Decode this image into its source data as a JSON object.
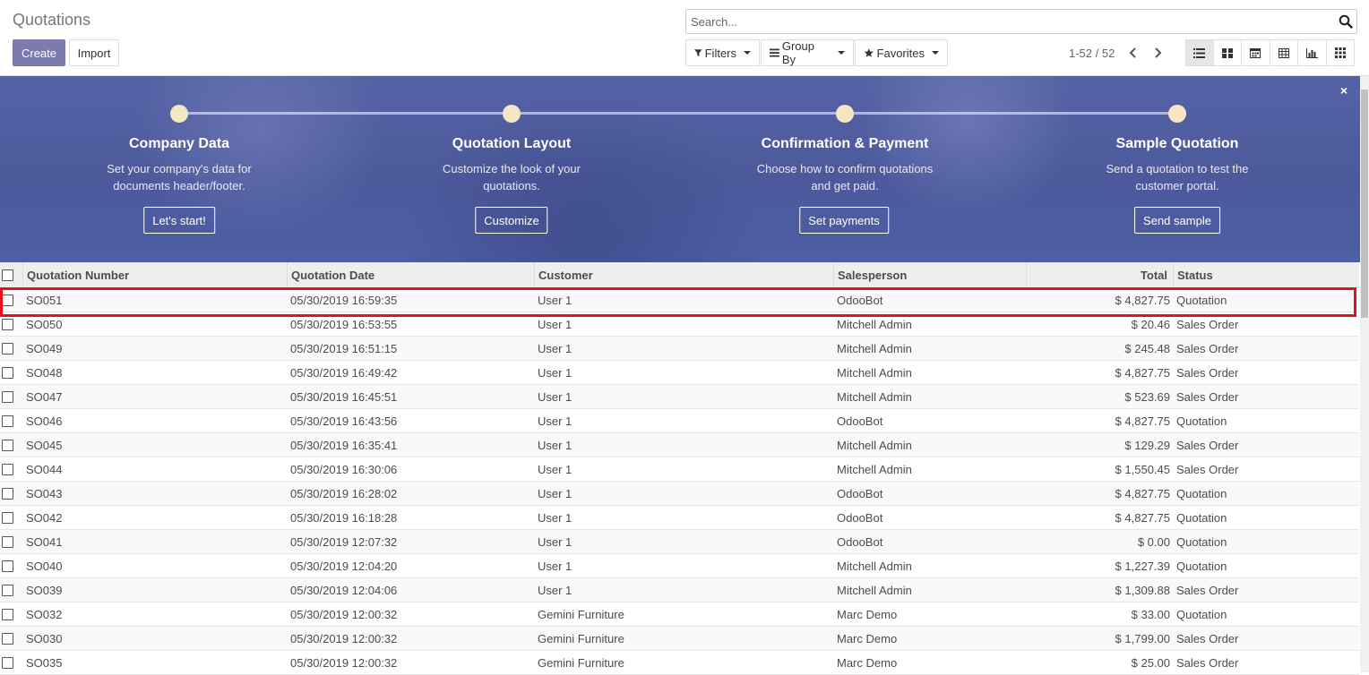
{
  "page": {
    "title": "Quotations"
  },
  "buttons": {
    "create": "Create",
    "import": "Import"
  },
  "search": {
    "placeholder": "Search..."
  },
  "filters": {
    "filters": "Filters",
    "group_by": "Group By",
    "favorites": "Favorites"
  },
  "pager": {
    "text": "1-52 / 52"
  },
  "views": [
    "list-view-icon",
    "kanban-view-icon",
    "calendar-view-icon",
    "pivot-view-icon",
    "graph-view-icon",
    "activity-view-icon"
  ],
  "banner": {
    "close": "×",
    "steps": [
      {
        "title": "Company Data",
        "desc1": "Set your company's data for",
        "desc2": "documents header/footer.",
        "button": "Let's start!"
      },
      {
        "title": "Quotation Layout",
        "desc1": "Customize the look of your",
        "desc2": "quotations.",
        "button": "Customize"
      },
      {
        "title": "Confirmation & Payment",
        "desc1": "Choose how to confirm quotations",
        "desc2": "and get paid.",
        "button": "Set payments"
      },
      {
        "title": "Sample Quotation",
        "desc1": "Send a quotation to test the",
        "desc2": "customer portal.",
        "button": "Send sample"
      }
    ]
  },
  "table": {
    "headers": [
      "Quotation Number",
      "Quotation Date",
      "Customer",
      "Salesperson",
      "Total",
      "Status"
    ],
    "rows": [
      [
        "SO051",
        "05/30/2019 16:59:35",
        "User 1",
        "OdooBot",
        "$ 4,827.75",
        "Quotation"
      ],
      [
        "SO050",
        "05/30/2019 16:53:55",
        "User 1",
        "Mitchell Admin",
        "$ 20.46",
        "Sales Order"
      ],
      [
        "SO049",
        "05/30/2019 16:51:15",
        "User 1",
        "Mitchell Admin",
        "$ 245.48",
        "Sales Order"
      ],
      [
        "SO048",
        "05/30/2019 16:49:42",
        "User 1",
        "Mitchell Admin",
        "$ 4,827.75",
        "Sales Order"
      ],
      [
        "SO047",
        "05/30/2019 16:45:51",
        "User 1",
        "Mitchell Admin",
        "$ 523.69",
        "Sales Order"
      ],
      [
        "SO046",
        "05/30/2019 16:43:56",
        "User 1",
        "OdooBot",
        "$ 4,827.75",
        "Quotation"
      ],
      [
        "SO045",
        "05/30/2019 16:35:41",
        "User 1",
        "Mitchell Admin",
        "$ 129.29",
        "Sales Order"
      ],
      [
        "SO044",
        "05/30/2019 16:30:06",
        "User 1",
        "Mitchell Admin",
        "$ 1,550.45",
        "Sales Order"
      ],
      [
        "SO043",
        "05/30/2019 16:28:02",
        "User 1",
        "OdooBot",
        "$ 4,827.75",
        "Quotation"
      ],
      [
        "SO042",
        "05/30/2019 16:18:28",
        "User 1",
        "OdooBot",
        "$ 4,827.75",
        "Quotation"
      ],
      [
        "SO041",
        "05/30/2019 12:07:32",
        "User 1",
        "OdooBot",
        "$ 0.00",
        "Quotation"
      ],
      [
        "SO040",
        "05/30/2019 12:04:20",
        "User 1",
        "Mitchell Admin",
        "$ 1,227.39",
        "Quotation"
      ],
      [
        "SO039",
        "05/30/2019 12:04:06",
        "User 1",
        "Mitchell Admin",
        "$ 1,309.88",
        "Sales Order"
      ],
      [
        "SO032",
        "05/30/2019 12:00:32",
        "Gemini Furniture",
        "Marc Demo",
        "$ 33.00",
        "Quotation"
      ],
      [
        "SO030",
        "05/30/2019 12:00:32",
        "Gemini Furniture",
        "Marc Demo",
        "$ 1,799.00",
        "Sales Order"
      ],
      [
        "SO035",
        "05/30/2019 12:00:32",
        "Gemini Furniture",
        "Marc Demo",
        "$ 25.00",
        "Sales Order"
      ]
    ]
  }
}
